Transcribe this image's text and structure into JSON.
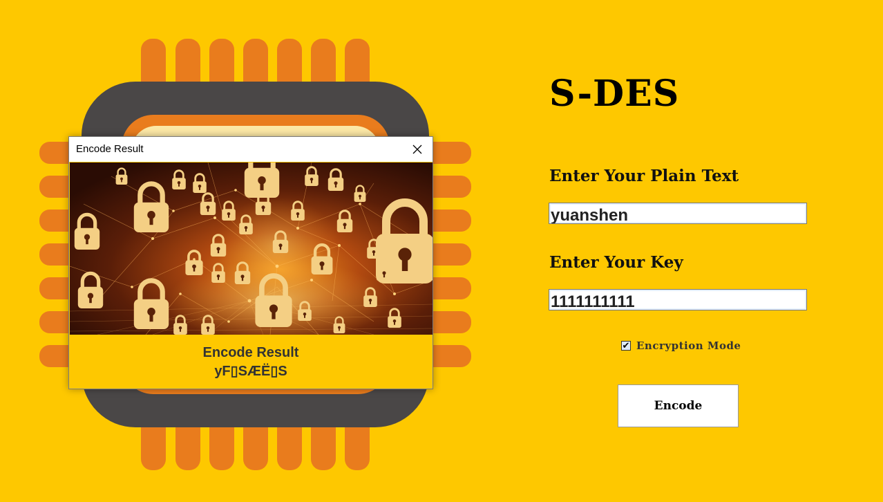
{
  "app": {
    "title": "S-DES",
    "plain_label": "Enter Your Plain Text",
    "plain_value": "yuanshen",
    "key_label": "Enter Your Key",
    "key_value": "1111111111",
    "mode_checked": true,
    "mode_label": "Encryption Mode",
    "encode_button": "Encode"
  },
  "dialog": {
    "title": "Encode Result",
    "heading": "Encode Result",
    "value": "yF▯SÆË▯S"
  },
  "colors": {
    "background": "#FEC800",
    "chip_body": "#4A4747",
    "chip_pins": "#E97C1D",
    "chip_core": "#FCE8A6"
  },
  "icons": {
    "dialog_close": "close-icon",
    "checkbox_mark": "checkmark-icon",
    "dialog_image": "padlocks-network-image"
  }
}
